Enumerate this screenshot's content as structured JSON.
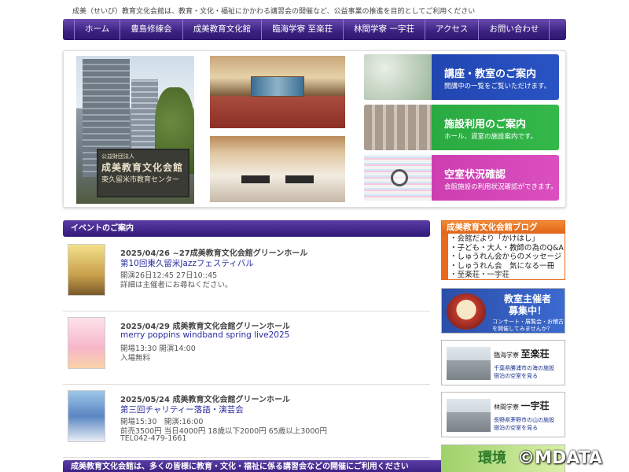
{
  "header": {
    "tagline": "成美（せいび）教育文化会館は、教育・文化・福祉にかかわる講習会の開催など、公益事業の推進を目的としてご利用ください"
  },
  "nav": {
    "items": [
      "ホーム",
      "豊島修練会",
      "成美教育文化館",
      "臨海学寮 至楽荘",
      "林間学寮 一宇荘",
      "アクセス",
      "お問い合わせ"
    ]
  },
  "hero": {
    "sign": {
      "small": "公益財団法人",
      "main": "成美教育文化会館",
      "sub": "東久留米市教育センター"
    },
    "panels": [
      {
        "title": "講座・教室のご案内",
        "subtitle": "開講中の一覧をご覧いただけます。"
      },
      {
        "title": "施設利用のご案内",
        "subtitle": "ホール、貸室の施設案内です。"
      },
      {
        "title": "空室状況確認",
        "subtitle": "会館施設の利用状況確認ができます。"
      }
    ]
  },
  "events": {
    "header": "イベントのご案内",
    "items": [
      {
        "date": "2025/04/26 ~27成美教育文化会館グリーンホール",
        "title": "第10回東久留米Jazzフェスティバル",
        "line1": "開演26日12:45 27日10::45",
        "line2": "詳細は主催者にお尋ねください。",
        "line3": ""
      },
      {
        "date": "2025/04/29 成美教育文化会館グリーンホール",
        "title": "merry poppins windband spring live2025",
        "line1": "開場13:30 開演14:00",
        "line2": "入場無料",
        "line3": ""
      },
      {
        "date": "2025/05/24 成美教育文化会館グリーンホール",
        "title": "第三回チャリティー落語・演芸会",
        "line1": "開場15:30　開演:16:00",
        "line2": "前売3500円 当日4000円 18歳以下2000円 65歳以上3000円",
        "line3": "TEL042-479-1661"
      }
    ]
  },
  "footer_bar": "成美教育文化会館は、多くの皆様に教育・文化・福祉に係る講習会などの開催にご利用ください",
  "sidebar": {
    "blog": {
      "title": "成美教育文化会館ブログ",
      "items": [
        "・会館だより「かけはし」",
        "・子ども・大人・教師の為のQ&A",
        "・しゅうれん会からのメッセージ",
        "・しゅうれん会　気になる一冊",
        "・至楽荘・一宇荘"
      ]
    },
    "recruit": {
      "title": "教室主催者\n募集中！",
      "subtitle": "コンサート・展覧会・お稽古を開催してみませんか？"
    },
    "shirakaso": {
      "prefix": "臨海学寮",
      "name": "至楽荘",
      "desc1": "千葉県勝浦市の海の施設",
      "desc2": "宿泊の空室を見る"
    },
    "ichuso": {
      "prefix": "林間学寮",
      "name": "一宇荘",
      "desc1": "長野県茅野市の山の施設",
      "desc2": "宿泊の空室を見る"
    },
    "env_text": "環境"
  },
  "watermark": "©MDATA"
}
